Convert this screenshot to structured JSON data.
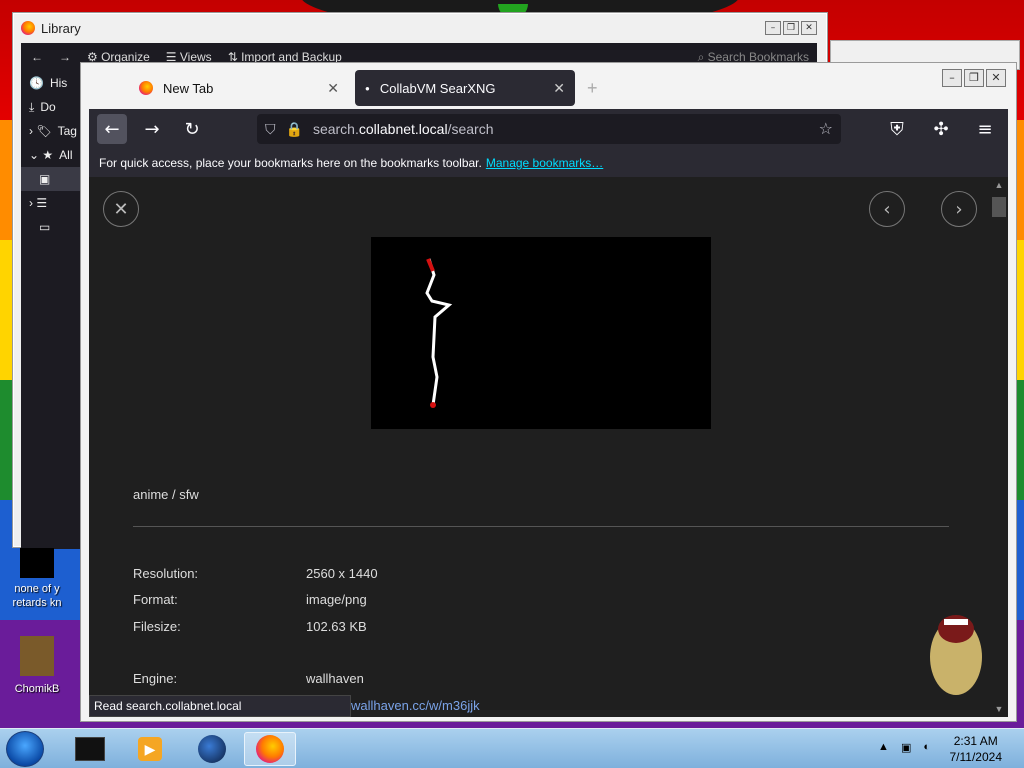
{
  "library": {
    "title": "Library",
    "toolbar": {
      "organize": "Organize",
      "views": "Views",
      "import": "Import and Backup",
      "search_placeholder": "Search Bookmarks"
    },
    "side_items": [
      "His",
      "Do",
      "Tag",
      "All"
    ]
  },
  "desktop": {
    "icon1_label": "none of y retards kn",
    "icon2_label": "ChomikB"
  },
  "browser": {
    "tabs": [
      {
        "label": "New Tab"
      },
      {
        "label": "CollabVM SearXNG"
      }
    ],
    "url_prefix": "search.",
    "url_domain": "collabnet.local",
    "url_path": "/search",
    "bookmarks_msg": "For quick access, place your bookmarks here on the bookmarks toolbar.",
    "manage_bookmarks": "Manage bookmarks…",
    "status_text": "Read search.collabnet.local"
  },
  "result": {
    "category": "anime / sfw",
    "rows": [
      {
        "label": "Resolution:",
        "value": "2560 x 1440"
      },
      {
        "label": "Format:",
        "value": "image/png"
      },
      {
        "label": "Filesize:",
        "value": "102.63 KB"
      },
      {
        "label": "Engine:",
        "value": "wallhaven"
      }
    ],
    "source_link": "wallhaven.cc/w/m36jjk"
  },
  "taskbar": {
    "time": "2:31 AM",
    "date": "7/11/2024"
  },
  "colors": {
    "accent_link": "#00ddff",
    "tab_active": "#2b2a33",
    "content_bg": "#1f1f1f"
  }
}
